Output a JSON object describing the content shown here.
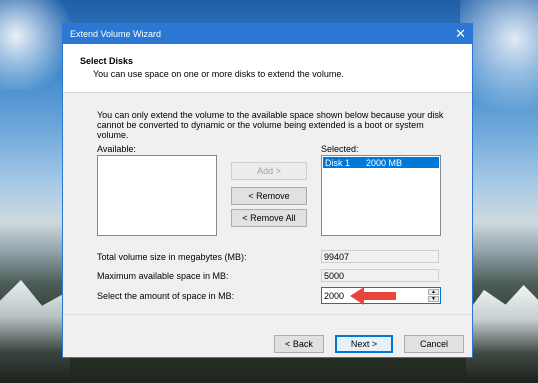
{
  "window": {
    "title": "Extend Volume Wizard",
    "close_glyph": "✕"
  },
  "header": {
    "title": "Select Disks",
    "subtitle": "You can use space on one or more disks to extend the volume."
  },
  "intro": "You can only extend the volume to the available space shown below because your disk cannot be converted to dynamic or the volume being extended is a boot or system volume.",
  "lists": {
    "available_label": "Available:",
    "selected_label": "Selected:",
    "selected_items": [
      {
        "name": "Disk 1",
        "size": "2000 MB"
      }
    ]
  },
  "buttons": {
    "add": "Add >",
    "remove": "< Remove",
    "remove_all": "< Remove All",
    "back": "< Back",
    "next": "Next >",
    "cancel": "Cancel"
  },
  "fields": {
    "total_label": "Total volume size in megabytes (MB):",
    "total_value": "99407",
    "max_label": "Maximum available space in MB:",
    "max_value": "5000",
    "amount_label": "Select the amount of space in MB:",
    "amount_value": "2000"
  },
  "colors": {
    "accent": "#2b78d4",
    "selection": "#0078d7",
    "annotation_arrow": "#e8463a"
  },
  "icons": {
    "spin_up": "▲",
    "spin_down": "▼"
  }
}
